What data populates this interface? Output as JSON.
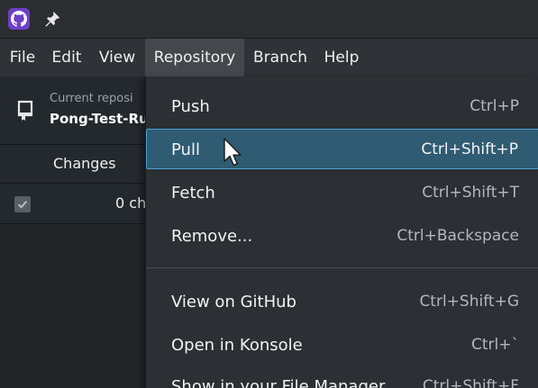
{
  "titlebar": {
    "app_icon": "github-icon",
    "pin_icon": "pin-icon"
  },
  "menubar": {
    "items": [
      "File",
      "Edit",
      "View",
      "Repository",
      "Branch",
      "Help"
    ],
    "active": "Repository"
  },
  "repository": {
    "caption": "Current reposi",
    "name": "Pong-Test-Ru",
    "icon": "repository-icon"
  },
  "tabs": {
    "changes": "Changes"
  },
  "changes": {
    "count_text": "0 ch",
    "checkbox_icon": "checkbox-icon"
  },
  "dropdown": {
    "items": [
      {
        "label": "Push",
        "shortcut": "Ctrl+P"
      },
      {
        "label": "Pull",
        "shortcut": "Ctrl+Shift+P"
      },
      {
        "label": "Fetch",
        "shortcut": "Ctrl+Shift+T"
      },
      {
        "label": "Remove...",
        "shortcut": "Ctrl+Backspace"
      },
      {
        "label": "View on GitHub",
        "shortcut": "Ctrl+Shift+G"
      },
      {
        "label": "Open in Konsole",
        "shortcut": "Ctrl+`"
      },
      {
        "label": "Show in your File Manager",
        "shortcut": "Ctrl+Shift+F"
      }
    ],
    "highlighted": "Pull"
  },
  "colors": {
    "highlight_bg": "#2f5b73",
    "highlight_border": "#4a9fd0",
    "app_icon_bg": "#6e40c9"
  }
}
